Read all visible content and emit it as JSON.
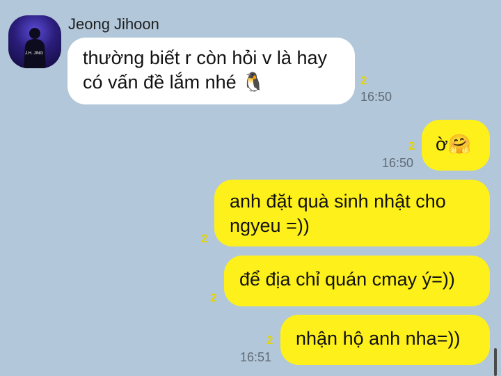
{
  "sender": {
    "name": "Jeong Jihoon",
    "avatar_text": "J.H. JING"
  },
  "messages": [
    {
      "text": "thường biết r còn hỏi v là hay có vấn đề lắm nhé",
      "emoji": "🐧",
      "unread": "2",
      "time": "16:50"
    },
    {
      "text": "ờ",
      "emoji": "🤗",
      "unread": "2",
      "time": "16:50"
    },
    {
      "text": "anh đặt quà sinh nhật cho ngyeu =))",
      "unread": "2"
    },
    {
      "text": "để địa chỉ quán cmay ý=))",
      "unread": "2"
    },
    {
      "text": "nhận hộ anh nha=))",
      "unread": "2",
      "time": "16:51"
    }
  ],
  "colors": {
    "background": "#b2c7da",
    "incoming": "#ffffff",
    "outgoing": "#fef01b",
    "unread": "#e6d400"
  }
}
